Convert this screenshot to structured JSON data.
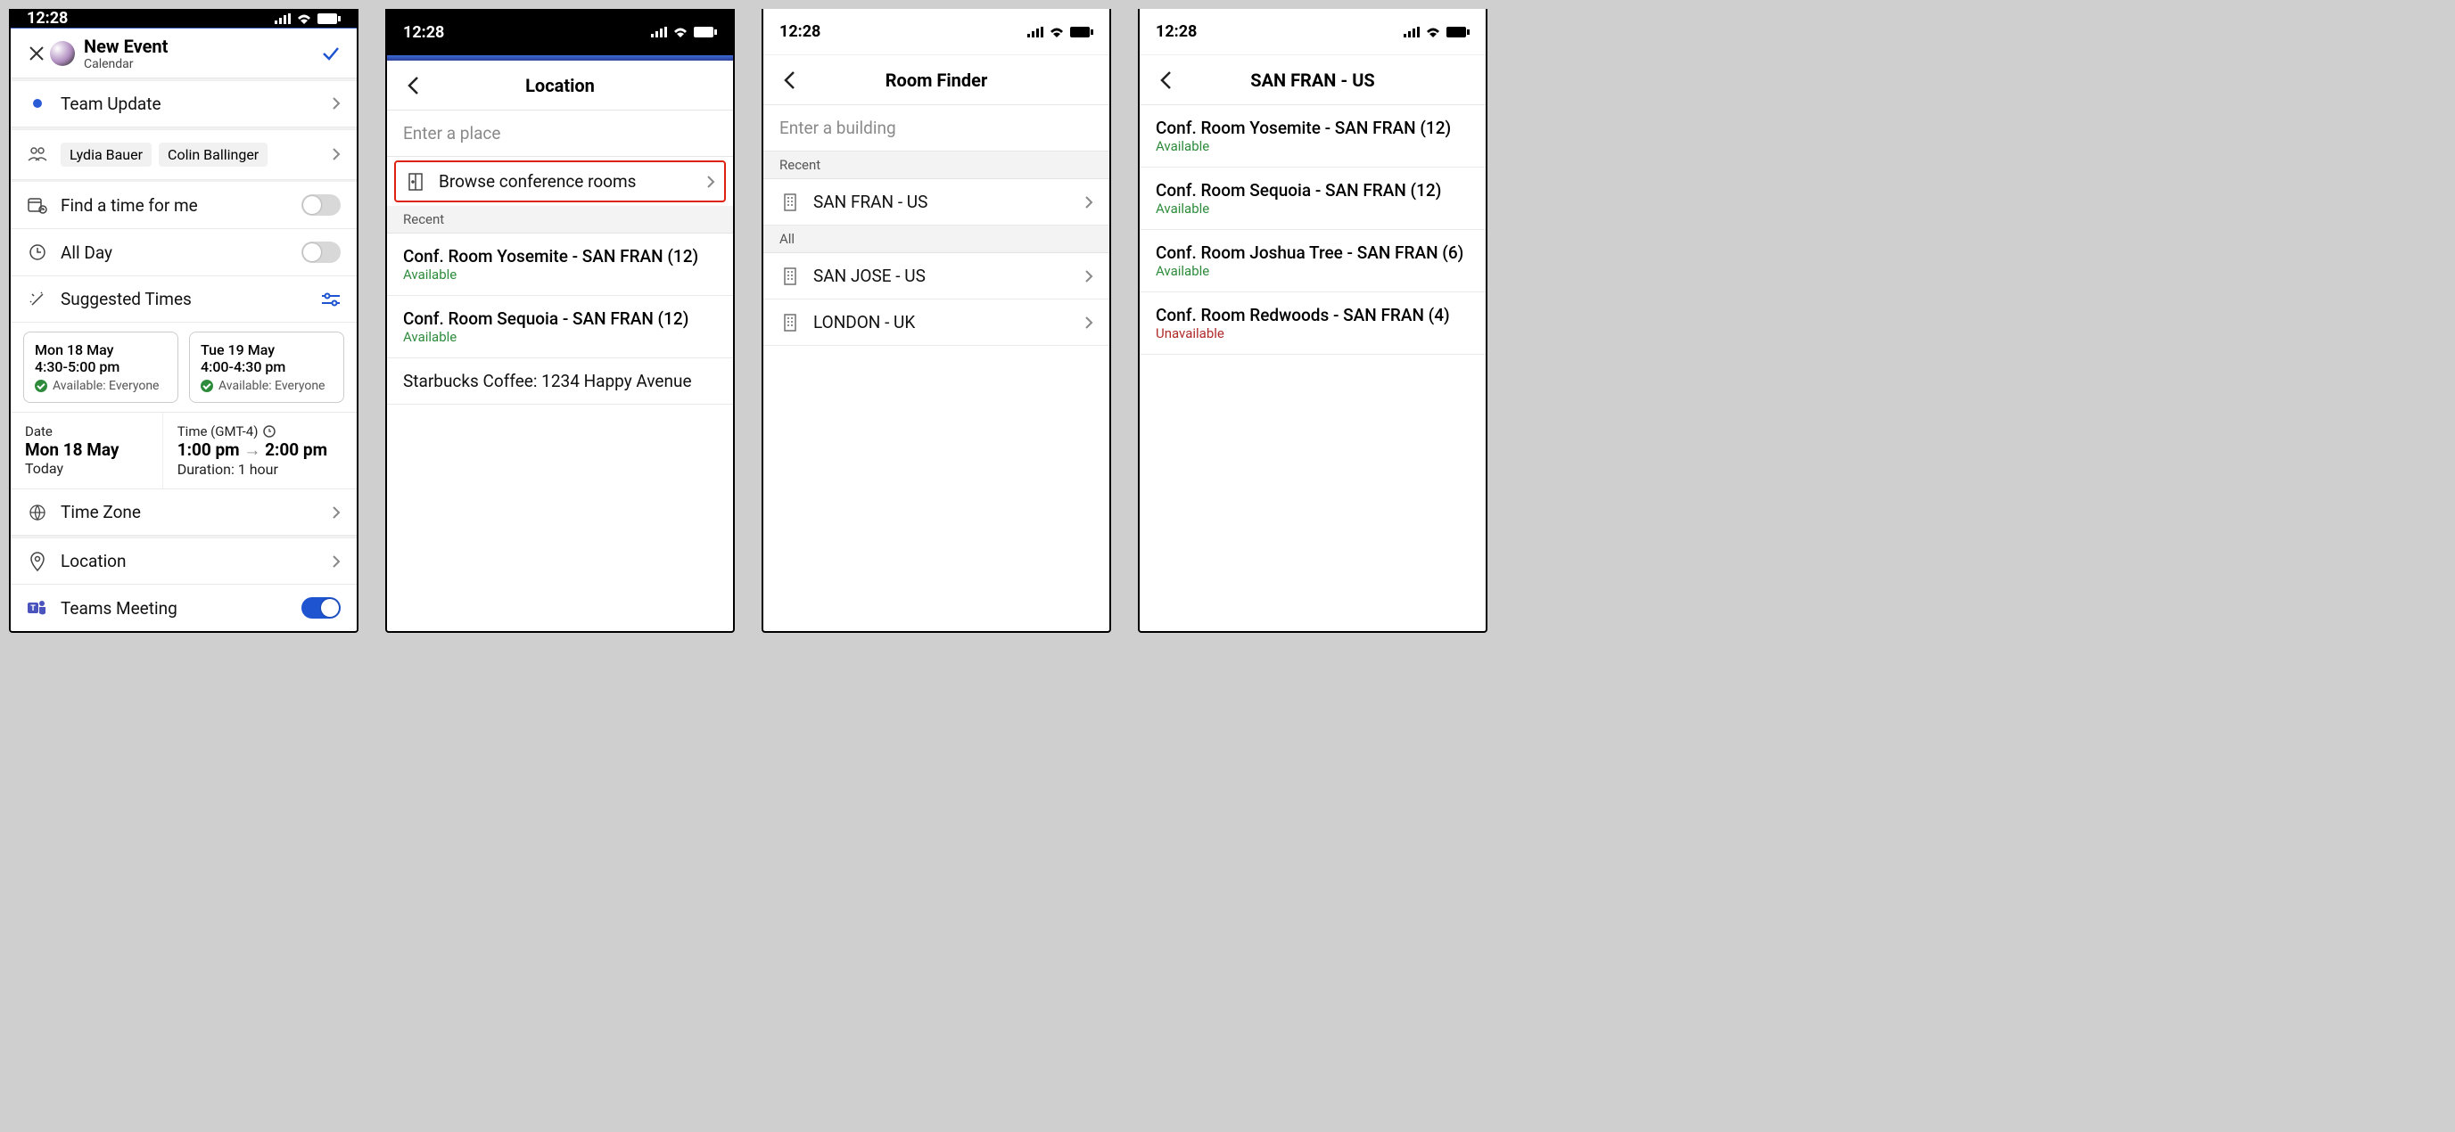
{
  "statusbar": {
    "time": "12:28"
  },
  "screen1": {
    "header": {
      "title": "New Event",
      "subtitle": "Calendar"
    },
    "eventTitle": "Team Update",
    "attendees": [
      "Lydia Bauer",
      "Colin Ballinger"
    ],
    "findTime": "Find a time for me",
    "allDay": "All Day",
    "suggestedHeader": "Suggested Times",
    "suggestions": [
      {
        "date": "Mon 18 May",
        "time": "4:30-5:00 pm",
        "avail": "Available: Everyone"
      },
      {
        "date": "Tue 19 May",
        "time": "4:00-4:30 pm",
        "avail": "Available: Everyone"
      }
    ],
    "dt": {
      "dateLabel": "Date",
      "dateVal": "Mon 18 May",
      "dateSub": "Today",
      "timeLabel": "Time (GMT-4)",
      "timeStart": "1:00 pm",
      "timeEnd": "2:00 pm",
      "durationLabel": "Duration: 1 hour"
    },
    "timezone": "Time Zone",
    "location": "Location",
    "teams": "Teams Meeting"
  },
  "screen2": {
    "header": "Location",
    "placeholder": "Enter a place",
    "browse": "Browse conference rooms",
    "recentHeader": "Recent",
    "rooms": [
      {
        "name": "Conf. Room Yosemite - SAN FRAN (12)",
        "status": "Available"
      },
      {
        "name": "Conf. Room Sequoia - SAN FRAN (12)",
        "status": "Available"
      }
    ],
    "extra": "Starbucks Coffee: 1234 Happy Avenue"
  },
  "screen3": {
    "header": "Room Finder",
    "placeholder": "Enter a building",
    "recentHeader": "Recent",
    "recent": [
      "SAN FRAN - US"
    ],
    "allHeader": "All",
    "all": [
      "SAN JOSE - US",
      "LONDON - UK"
    ]
  },
  "screen4": {
    "header": "SAN FRAN - US",
    "rooms": [
      {
        "name": "Conf. Room Yosemite - SAN FRAN (12)",
        "status": "Available",
        "ok": true
      },
      {
        "name": "Conf. Room Sequoia - SAN FRAN (12)",
        "status": "Available",
        "ok": true
      },
      {
        "name": "Conf. Room Joshua Tree - SAN FRAN (6)",
        "status": "Available",
        "ok": true
      },
      {
        "name": "Conf. Room Redwoods - SAN FRAN (4)",
        "status": "Unavailable",
        "ok": false
      }
    ]
  }
}
